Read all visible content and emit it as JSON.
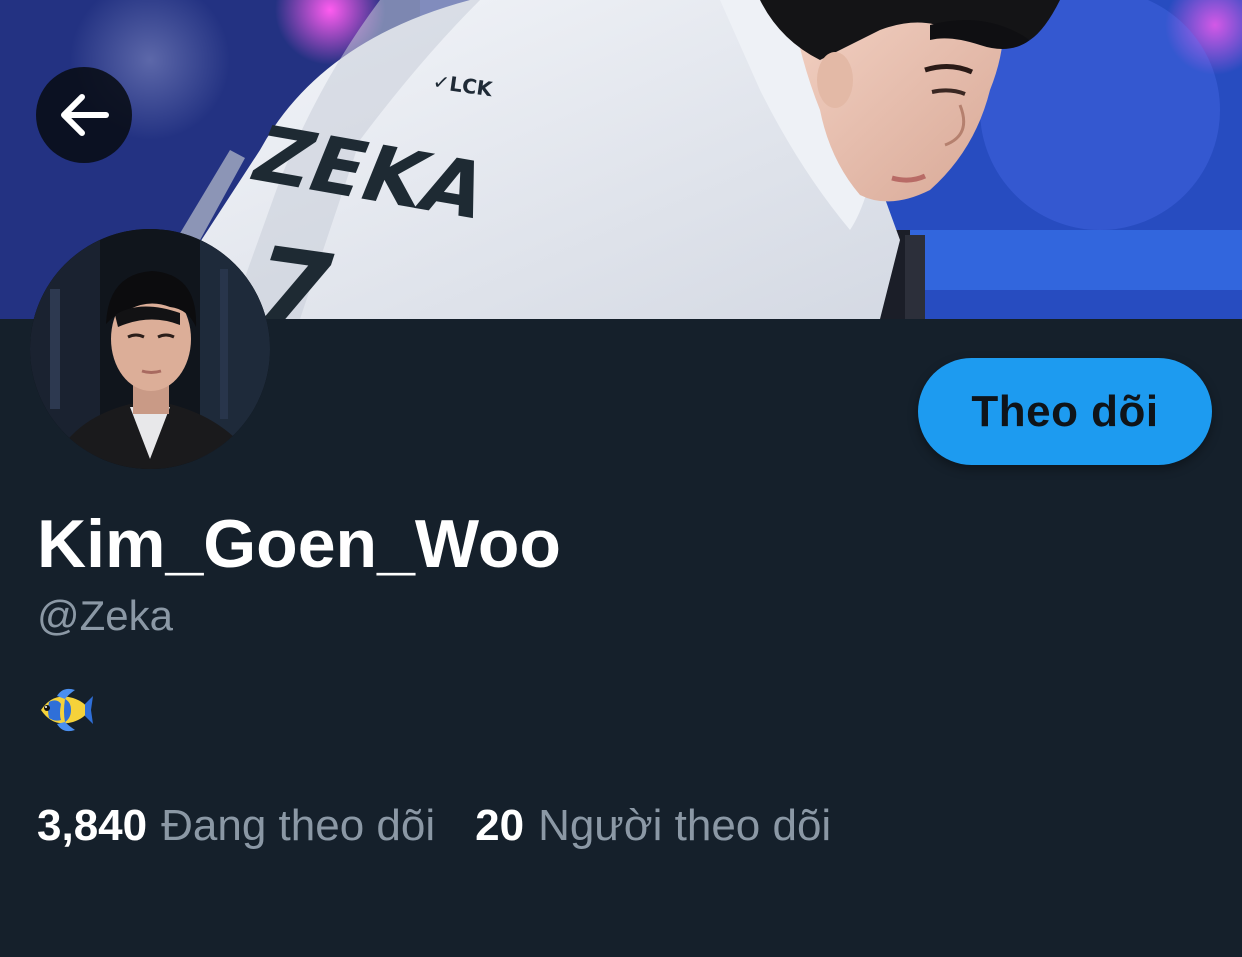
{
  "profile": {
    "display_name": "Kim_Goen_Woo",
    "handle": "@Zeka",
    "bio_emoji": "tropical-fish"
  },
  "banner": {
    "jersey_name": "ZEKA",
    "jersey_number": "7",
    "jersey_logo": "LCK"
  },
  "actions": {
    "follow_label": "Theo dõi",
    "back_icon": "arrow-left-icon"
  },
  "stats": {
    "following_count": "3,840",
    "following_label": "Đang theo dõi",
    "followers_count": "20",
    "followers_label": "Người theo dõi"
  },
  "colors": {
    "background": "#15202b",
    "accent": "#1d9bf0",
    "secondary_text": "#8b98a5",
    "primary_text": "#ffffff"
  }
}
